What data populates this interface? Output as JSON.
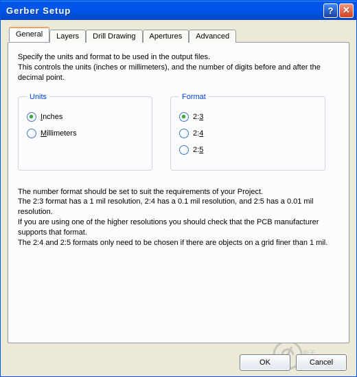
{
  "window": {
    "title": "Gerber Setup"
  },
  "tabs": {
    "items": [
      {
        "label": "General"
      },
      {
        "label": "Layers"
      },
      {
        "label": "Drill Drawing"
      },
      {
        "label": "Apertures"
      },
      {
        "label": "Advanced"
      }
    ],
    "active_index": 0
  },
  "general": {
    "description_line1": "Specify the units and format to be used in the output files.",
    "description_line2": "This controls the units (inches or millimeters), and the number of digits before and after the decimal point.",
    "units": {
      "legend": "Units",
      "options": [
        {
          "label": "Inches",
          "underline_char": "I",
          "selected": true
        },
        {
          "label": "Millimeters",
          "underline_char": "M",
          "selected": false
        }
      ]
    },
    "format": {
      "legend": "Format",
      "options": [
        {
          "label": "2:3",
          "underline_char": "3",
          "selected": true
        },
        {
          "label": "2:4",
          "underline_char": "4",
          "selected": false
        },
        {
          "label": "2:5",
          "underline_char": "5",
          "selected": false
        }
      ]
    },
    "explain_line1": "The number format should be set to suit the requirements of your Project.",
    "explain_line2": "The 2:3 format has a 1 mil resolution, 2:4 has a 0.1 mil resolution, and 2:5 has a 0.01 mil resolution.",
    "explain_line3": "If you are using one of the higher resolutions you should check that the PCB manufacturer supports that format.",
    "explain_line4": "The 2:4 and 2:5 formats only need to be chosen if there are objects on a grid finer than 1 mil."
  },
  "buttons": {
    "ok": "OK",
    "cancel": "Cancel"
  }
}
